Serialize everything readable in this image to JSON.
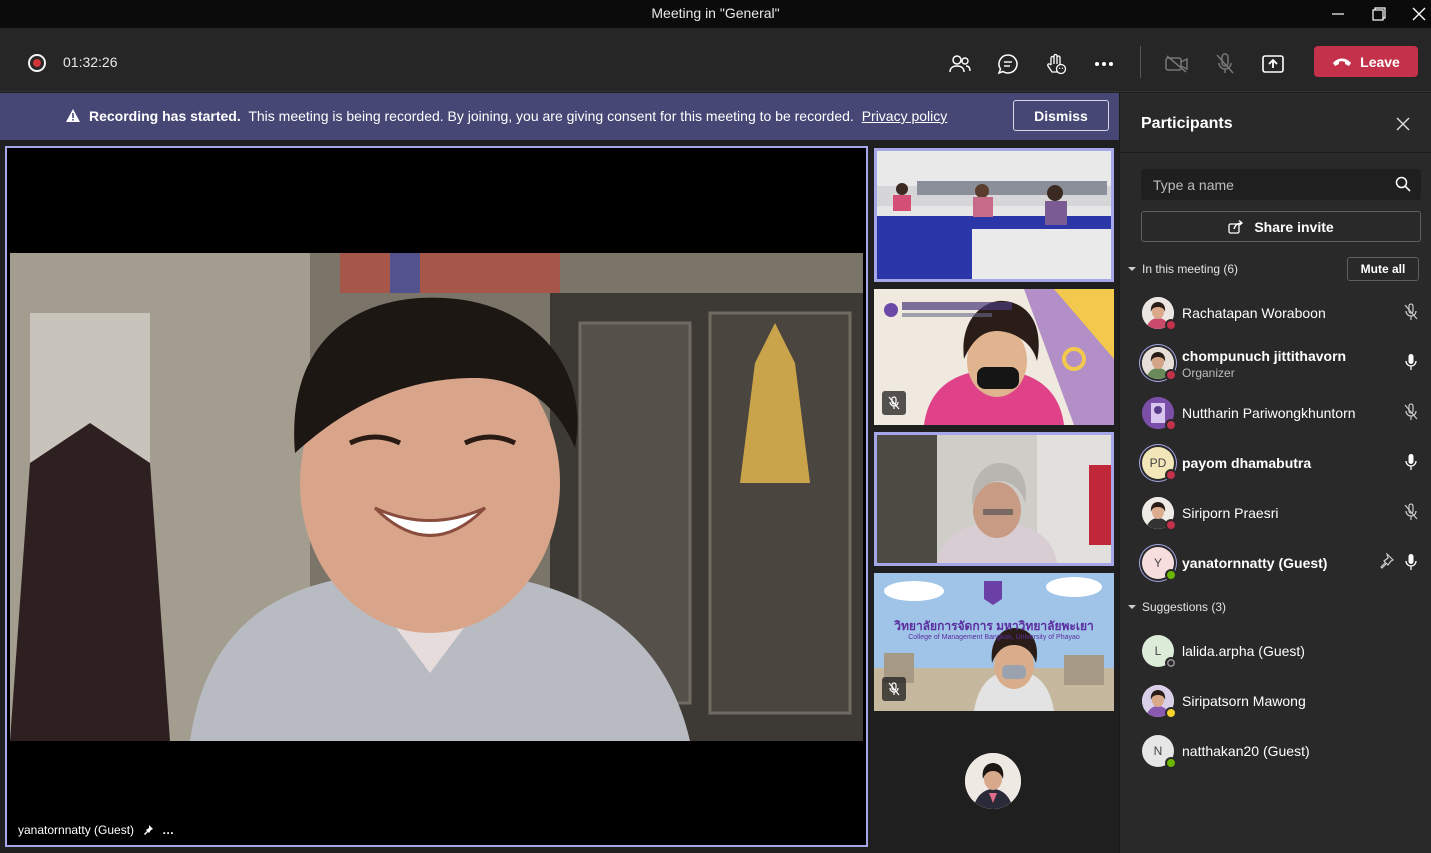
{
  "window": {
    "title": "Meeting in \"General\""
  },
  "toolbar": {
    "timer": "01:32:26",
    "leave_label": "Leave"
  },
  "banner": {
    "bold": "Recording has started.",
    "text": "This meeting is being recorded. By joining, you are giving consent for this meeting to be recorded.",
    "link": "Privacy policy",
    "dismiss": "Dismiss"
  },
  "main": {
    "name": "yanatornnatty (Guest)",
    "more": "…"
  },
  "thumbs": {
    "college_th": "วิทยาลัยการจัดการ มหาวิทยาลัยพะเยา",
    "college_en": "College of Management Bangkok, University of Phayao"
  },
  "pane": {
    "title": "Participants",
    "search_placeholder": "Type a name",
    "share_invite": "Share invite",
    "in_meeting": "In this meeting (6)",
    "mute_all": "Mute all",
    "suggestions": "Suggestions (3)",
    "participants": [
      {
        "name": "Rachatapan Woraboon",
        "role": "",
        "initials": "",
        "status": "red",
        "mic": "muted"
      },
      {
        "name": "chompunuch jittithavorn",
        "role": "Organizer",
        "initials": "",
        "status": "red",
        "mic": "on"
      },
      {
        "name": "Nuttharin Pariwongkhuntorn",
        "role": "",
        "initials": "",
        "status": "red",
        "mic": "muted"
      },
      {
        "name": "payom dhamabutra",
        "role": "",
        "initials": "PD",
        "status": "red",
        "mic": "on"
      },
      {
        "name": "Siriporn Praesri",
        "role": "",
        "initials": "",
        "status": "red",
        "mic": "muted"
      },
      {
        "name": "yanatornnatty (Guest)",
        "role": "",
        "initials": "Y",
        "status": "green",
        "mic": "on"
      }
    ],
    "suggested": [
      {
        "name": "lalida.arpha (Guest)",
        "initials": "L",
        "status": "gray"
      },
      {
        "name": "Siripatsorn Mawong",
        "initials": "",
        "status": "yellow"
      },
      {
        "name": "natthakan20 (Guest)",
        "initials": "N",
        "status": "green"
      }
    ]
  },
  "colors": {
    "accent": "#a6a7e8",
    "leave": "#c4314b",
    "banner": "#464775",
    "status_red": "#c4314b",
    "status_green": "#6bb700"
  }
}
